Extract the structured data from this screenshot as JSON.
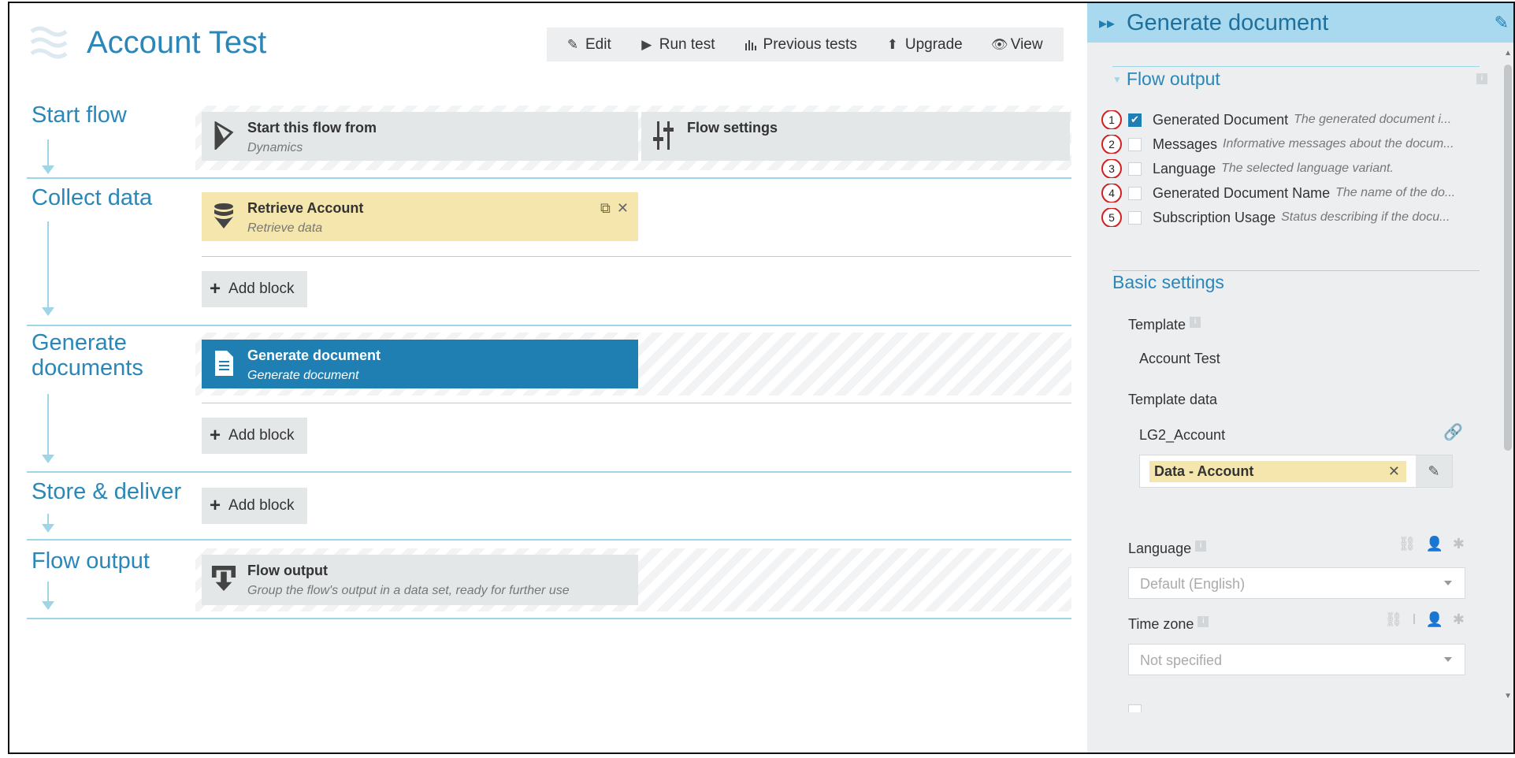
{
  "app": {
    "title": "Account Test"
  },
  "toolbar": {
    "edit": "Edit",
    "run_test": "Run test",
    "previous_tests": "Previous tests",
    "upgrade": "Upgrade",
    "view": "View"
  },
  "sections": {
    "start": {
      "label": "Start flow",
      "start_block_title": "Start this flow from",
      "start_block_sub": "Dynamics",
      "settings_block_title": "Flow settings"
    },
    "collect": {
      "label": "Collect data",
      "block_title": "Retrieve Account",
      "block_sub": "Retrieve data",
      "add_block": "Add block"
    },
    "generate": {
      "label": "Generate documents",
      "block_title": "Generate document",
      "block_sub": "Generate document",
      "add_block": "Add block"
    },
    "store": {
      "label": "Store & deliver",
      "add_block": "Add block"
    },
    "output": {
      "label": "Flow output",
      "block_title": "Flow output",
      "block_sub": "Group the flow's output in a data set, ready for further use"
    }
  },
  "panel": {
    "title": "Generate document",
    "flow_output": {
      "title": "Flow output",
      "items": [
        {
          "num": "1",
          "name": "Generated Document",
          "desc": "The generated document i...",
          "checked": true
        },
        {
          "num": "2",
          "name": "Messages",
          "desc": "Informative messages about the docum...",
          "checked": false
        },
        {
          "num": "3",
          "name": "Language",
          "desc": "The selected language variant.",
          "checked": false
        },
        {
          "num": "4",
          "name": "Generated Document Name",
          "desc": "The name of the do...",
          "checked": false
        },
        {
          "num": "5",
          "name": "Subscription Usage",
          "desc": "Status describing if the docu...",
          "checked": false
        }
      ]
    },
    "basic_settings": {
      "title": "Basic settings",
      "template_label": "Template",
      "template_value": "Account Test",
      "template_data_label": "Template data",
      "template_data_name": "LG2_Account",
      "template_data_pill": "Data - Account",
      "language_label": "Language",
      "language_value": "Default (English)",
      "timezone_label": "Time zone",
      "timezone_value": "Not specified"
    }
  },
  "colors": {
    "accent": "#2a87b8",
    "panel_header": "#a8d9ee",
    "block_blue": "#1f7fb2",
    "block_yellow": "#f4e6ad",
    "block_gray": "#e4e7e8",
    "annotation_red": "#d21f1f"
  }
}
